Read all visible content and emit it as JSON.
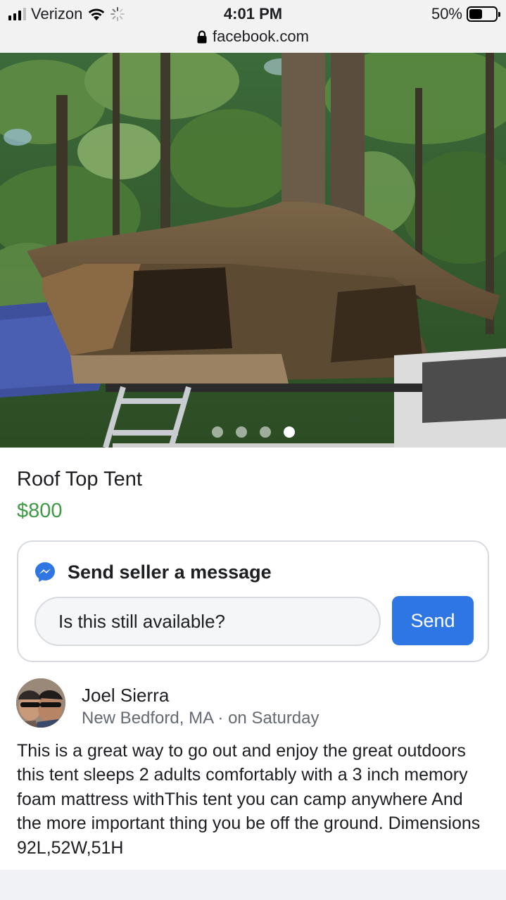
{
  "status_bar": {
    "carrier": "Verizon",
    "time": "4:01 PM",
    "battery": "50%",
    "battery_level": 0.5,
    "url": "facebook.com"
  },
  "listing": {
    "title": "Roof Top Tent",
    "price": "$800",
    "photo_count": 4,
    "active_photo_index": 3
  },
  "message": {
    "heading": "Send seller a message",
    "input_value": "Is this still available?",
    "send_label": "Send"
  },
  "seller": {
    "name": "Joel Sierra",
    "meta": "New Bedford, MA · on Saturday"
  },
  "description": "This is a great way to go out and enjoy the great outdoors this tent sleeps 2 adults comfortably with a 3 inch memory foam mattress  withThis tent you can camp anywhere And the more important thing you be off the ground. Dimensions 92L,52W,51H",
  "colors": {
    "price": "#3f9a45",
    "send_button": "#2d76e4",
    "messenger": "#2d76e4"
  },
  "icons": {
    "signal": "signal-bars-icon",
    "wifi": "wifi-icon",
    "loading": "activity-spinner-icon",
    "battery": "battery-icon",
    "lock": "lock-icon",
    "messenger": "messenger-icon"
  }
}
